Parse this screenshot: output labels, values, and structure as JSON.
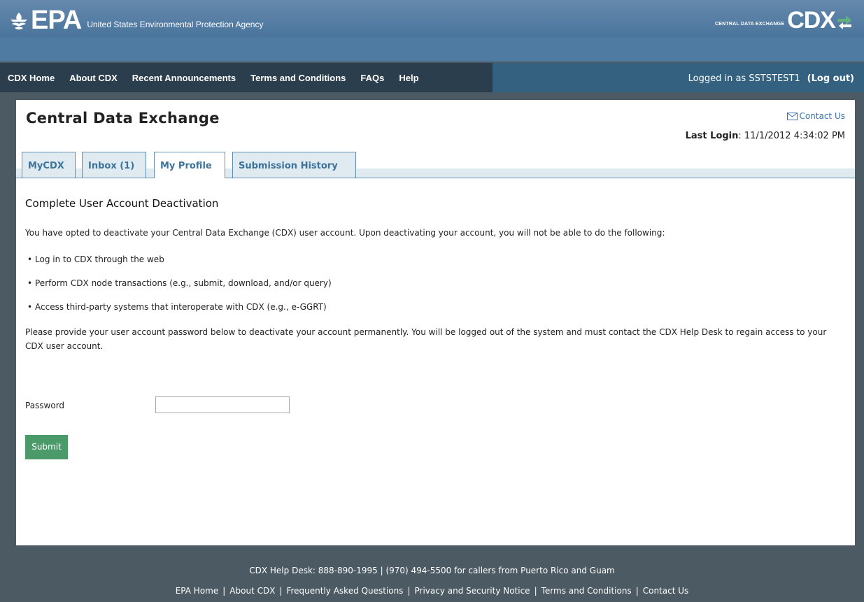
{
  "header": {
    "epa_text": "EPA",
    "agency_name": "United States Environmental Protection Agency",
    "cdx_subtitle": "CENTRAL DATA EXCHANGE",
    "cdx_text": "CDX",
    "brand_color": "#4f7aa1"
  },
  "nav": {
    "items": [
      "CDX Home",
      "About CDX",
      "Recent Announcements",
      "Terms and Conditions",
      "FAQs",
      "Help"
    ],
    "logged_in_text": "Logged in as SSTSTEST1",
    "logout_label": "(Log out)"
  },
  "page": {
    "title": "Central Data Exchange",
    "contact_label": "Contact Us",
    "last_login_label": "Last Login",
    "last_login_value": ": 11/1/2012 4:34:02 PM"
  },
  "tabs": [
    "MyCDX",
    "Inbox (1)",
    "My Profile",
    "Submission History"
  ],
  "active_tab": "My Profile",
  "content": {
    "section_title": "Complete User Account Deactivation",
    "intro": "You have opted to deactivate your Central Data Exchange (CDX) user account. Upon deactivating your account, you will not be able to do the following:",
    "bullets": [
      "Log in to CDX through the web",
      "Perform CDX node transactions (e.g., submit, download, and/or query)",
      "Access third-party systems that interoperate with CDX (e.g., e-GGRT)"
    ],
    "note": "Please provide your user account password below to deactivate your account permanently. You will be logged out of the system and must contact the CDX Help Desk to regain access to your CDX user account.",
    "password_label": "Password",
    "password_value": "",
    "submit_label": "Submit",
    "submit_color": "#4a9a6a"
  },
  "footer": {
    "helpdesk": "CDX Help Desk: 888-890-1995 | (970) 494-5500 for callers from Puerto Rico and Guam",
    "links": [
      "EPA Home",
      "About CDX",
      "Frequently Asked Questions",
      "Privacy and Security Notice",
      "Terms and Conditions",
      "Contact Us"
    ]
  }
}
